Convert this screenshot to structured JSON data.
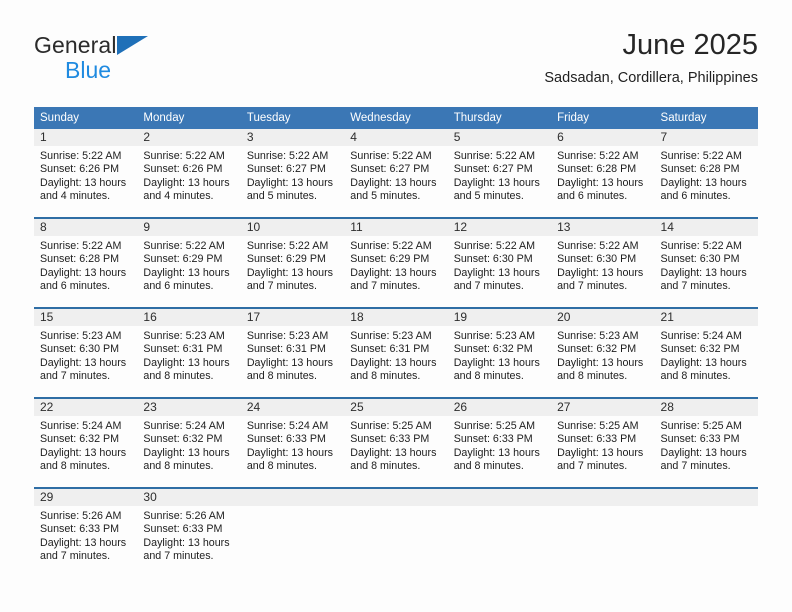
{
  "brand": {
    "line1": "General",
    "line2": "Blue",
    "triangle_color": "#1f70b8",
    "line2_color": "#1f8ae0"
  },
  "header": {
    "month_title": "June 2025",
    "location": "Sadsadan, Cordillera, Philippines"
  },
  "theme": {
    "header_blue": "#3b77b5",
    "separator_blue": "#2f6ea5",
    "daynum_gray": "#efefef",
    "page_background": "#fdfdfd"
  },
  "calendar": {
    "weekday_headers": [
      "Sunday",
      "Monday",
      "Tuesday",
      "Wednesday",
      "Thursday",
      "Friday",
      "Saturday"
    ],
    "weeks": [
      [
        {
          "day": "1",
          "sunrise": "Sunrise: 5:22 AM",
          "sunset": "Sunset: 6:26 PM",
          "daylight_line1": "Daylight: 13 hours",
          "daylight_line2": "and 4 minutes."
        },
        {
          "day": "2",
          "sunrise": "Sunrise: 5:22 AM",
          "sunset": "Sunset: 6:26 PM",
          "daylight_line1": "Daylight: 13 hours",
          "daylight_line2": "and 4 minutes."
        },
        {
          "day": "3",
          "sunrise": "Sunrise: 5:22 AM",
          "sunset": "Sunset: 6:27 PM",
          "daylight_line1": "Daylight: 13 hours",
          "daylight_line2": "and 5 minutes."
        },
        {
          "day": "4",
          "sunrise": "Sunrise: 5:22 AM",
          "sunset": "Sunset: 6:27 PM",
          "daylight_line1": "Daylight: 13 hours",
          "daylight_line2": "and 5 minutes."
        },
        {
          "day": "5",
          "sunrise": "Sunrise: 5:22 AM",
          "sunset": "Sunset: 6:27 PM",
          "daylight_line1": "Daylight: 13 hours",
          "daylight_line2": "and 5 minutes."
        },
        {
          "day": "6",
          "sunrise": "Sunrise: 5:22 AM",
          "sunset": "Sunset: 6:28 PM",
          "daylight_line1": "Daylight: 13 hours",
          "daylight_line2": "and 6 minutes."
        },
        {
          "day": "7",
          "sunrise": "Sunrise: 5:22 AM",
          "sunset": "Sunset: 6:28 PM",
          "daylight_line1": "Daylight: 13 hours",
          "daylight_line2": "and 6 minutes."
        }
      ],
      [
        {
          "day": "8",
          "sunrise": "Sunrise: 5:22 AM",
          "sunset": "Sunset: 6:28 PM",
          "daylight_line1": "Daylight: 13 hours",
          "daylight_line2": "and 6 minutes."
        },
        {
          "day": "9",
          "sunrise": "Sunrise: 5:22 AM",
          "sunset": "Sunset: 6:29 PM",
          "daylight_line1": "Daylight: 13 hours",
          "daylight_line2": "and 6 minutes."
        },
        {
          "day": "10",
          "sunrise": "Sunrise: 5:22 AM",
          "sunset": "Sunset: 6:29 PM",
          "daylight_line1": "Daylight: 13 hours",
          "daylight_line2": "and 7 minutes."
        },
        {
          "day": "11",
          "sunrise": "Sunrise: 5:22 AM",
          "sunset": "Sunset: 6:29 PM",
          "daylight_line1": "Daylight: 13 hours",
          "daylight_line2": "and 7 minutes."
        },
        {
          "day": "12",
          "sunrise": "Sunrise: 5:22 AM",
          "sunset": "Sunset: 6:30 PM",
          "daylight_line1": "Daylight: 13 hours",
          "daylight_line2": "and 7 minutes."
        },
        {
          "day": "13",
          "sunrise": "Sunrise: 5:22 AM",
          "sunset": "Sunset: 6:30 PM",
          "daylight_line1": "Daylight: 13 hours",
          "daylight_line2": "and 7 minutes."
        },
        {
          "day": "14",
          "sunrise": "Sunrise: 5:22 AM",
          "sunset": "Sunset: 6:30 PM",
          "daylight_line1": "Daylight: 13 hours",
          "daylight_line2": "and 7 minutes."
        }
      ],
      [
        {
          "day": "15",
          "sunrise": "Sunrise: 5:23 AM",
          "sunset": "Sunset: 6:30 PM",
          "daylight_line1": "Daylight: 13 hours",
          "daylight_line2": "and 7 minutes."
        },
        {
          "day": "16",
          "sunrise": "Sunrise: 5:23 AM",
          "sunset": "Sunset: 6:31 PM",
          "daylight_line1": "Daylight: 13 hours",
          "daylight_line2": "and 8 minutes."
        },
        {
          "day": "17",
          "sunrise": "Sunrise: 5:23 AM",
          "sunset": "Sunset: 6:31 PM",
          "daylight_line1": "Daylight: 13 hours",
          "daylight_line2": "and 8 minutes."
        },
        {
          "day": "18",
          "sunrise": "Sunrise: 5:23 AM",
          "sunset": "Sunset: 6:31 PM",
          "daylight_line1": "Daylight: 13 hours",
          "daylight_line2": "and 8 minutes."
        },
        {
          "day": "19",
          "sunrise": "Sunrise: 5:23 AM",
          "sunset": "Sunset: 6:32 PM",
          "daylight_line1": "Daylight: 13 hours",
          "daylight_line2": "and 8 minutes."
        },
        {
          "day": "20",
          "sunrise": "Sunrise: 5:23 AM",
          "sunset": "Sunset: 6:32 PM",
          "daylight_line1": "Daylight: 13 hours",
          "daylight_line2": "and 8 minutes."
        },
        {
          "day": "21",
          "sunrise": "Sunrise: 5:24 AM",
          "sunset": "Sunset: 6:32 PM",
          "daylight_line1": "Daylight: 13 hours",
          "daylight_line2": "and 8 minutes."
        }
      ],
      [
        {
          "day": "22",
          "sunrise": "Sunrise: 5:24 AM",
          "sunset": "Sunset: 6:32 PM",
          "daylight_line1": "Daylight: 13 hours",
          "daylight_line2": "and 8 minutes."
        },
        {
          "day": "23",
          "sunrise": "Sunrise: 5:24 AM",
          "sunset": "Sunset: 6:32 PM",
          "daylight_line1": "Daylight: 13 hours",
          "daylight_line2": "and 8 minutes."
        },
        {
          "day": "24",
          "sunrise": "Sunrise: 5:24 AM",
          "sunset": "Sunset: 6:33 PM",
          "daylight_line1": "Daylight: 13 hours",
          "daylight_line2": "and 8 minutes."
        },
        {
          "day": "25",
          "sunrise": "Sunrise: 5:25 AM",
          "sunset": "Sunset: 6:33 PM",
          "daylight_line1": "Daylight: 13 hours",
          "daylight_line2": "and 8 minutes."
        },
        {
          "day": "26",
          "sunrise": "Sunrise: 5:25 AM",
          "sunset": "Sunset: 6:33 PM",
          "daylight_line1": "Daylight: 13 hours",
          "daylight_line2": "and 8 minutes."
        },
        {
          "day": "27",
          "sunrise": "Sunrise: 5:25 AM",
          "sunset": "Sunset: 6:33 PM",
          "daylight_line1": "Daylight: 13 hours",
          "daylight_line2": "and 7 minutes."
        },
        {
          "day": "28",
          "sunrise": "Sunrise: 5:25 AM",
          "sunset": "Sunset: 6:33 PM",
          "daylight_line1": "Daylight: 13 hours",
          "daylight_line2": "and 7 minutes."
        }
      ],
      [
        {
          "day": "29",
          "sunrise": "Sunrise: 5:26 AM",
          "sunset": "Sunset: 6:33 PM",
          "daylight_line1": "Daylight: 13 hours",
          "daylight_line2": "and 7 minutes."
        },
        {
          "day": "30",
          "sunrise": "Sunrise: 5:26 AM",
          "sunset": "Sunset: 6:33 PM",
          "daylight_line1": "Daylight: 13 hours",
          "daylight_line2": "and 7 minutes."
        },
        {
          "day": "",
          "sunrise": "",
          "sunset": "",
          "daylight_line1": "",
          "daylight_line2": ""
        },
        {
          "day": "",
          "sunrise": "",
          "sunset": "",
          "daylight_line1": "",
          "daylight_line2": ""
        },
        {
          "day": "",
          "sunrise": "",
          "sunset": "",
          "daylight_line1": "",
          "daylight_line2": ""
        },
        {
          "day": "",
          "sunrise": "",
          "sunset": "",
          "daylight_line1": "",
          "daylight_line2": ""
        },
        {
          "day": "",
          "sunrise": "",
          "sunset": "",
          "daylight_line1": "",
          "daylight_line2": ""
        }
      ]
    ]
  }
}
